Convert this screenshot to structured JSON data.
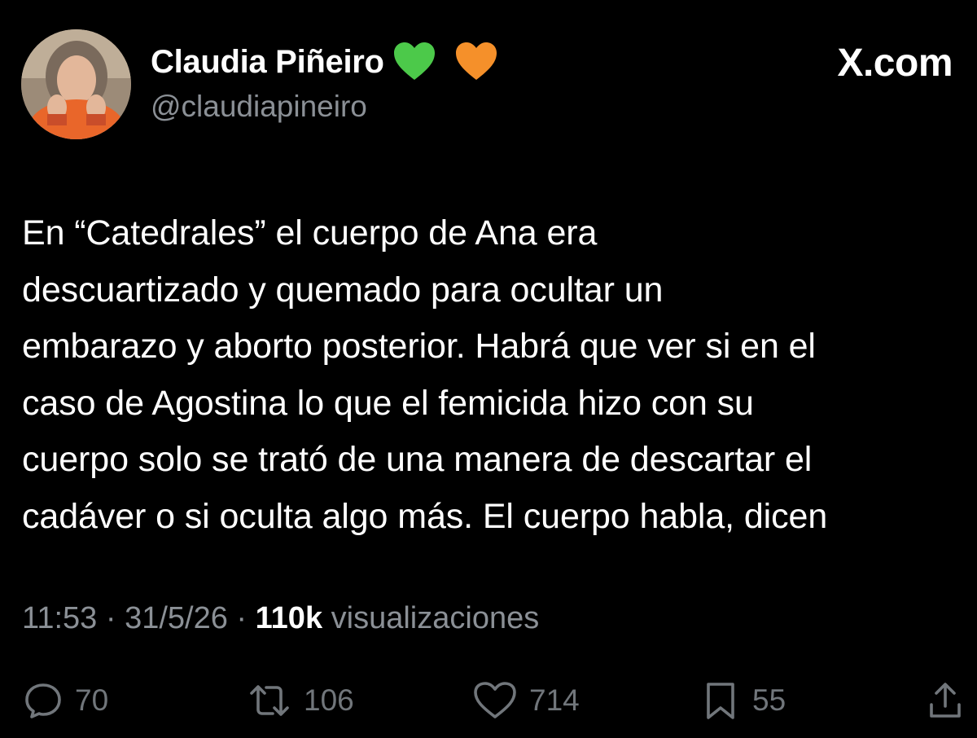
{
  "author": {
    "display_name": "Claudia Piñeiro",
    "handle": "@claudiapineiro",
    "badges": [
      "green-heart-icon",
      "orange-heart-icon"
    ],
    "avatar": "avatar-photo"
  },
  "brand": {
    "label": "X.com"
  },
  "tweet": {
    "lines": [
      "En “Catedrales” el cuerpo de Ana era",
      "descuartizado y quemado para ocultar un",
      "embarazo y aborto posterior. Habrá que ver si en el",
      "caso de Agostina lo que el femicida hizo con su",
      "cuerpo solo se trató de una manera de descartar el",
      "cadáver o si oculta algo más. El cuerpo habla, dicen"
    ]
  },
  "meta": {
    "time": "11:53",
    "sep1": " · ",
    "date": "31/5/26",
    "sep2": " · ",
    "views_count": "110k",
    "views_label": " visualizaciones"
  },
  "actions": {
    "replies": {
      "icon": "reply-icon",
      "count": "70"
    },
    "reposts": {
      "icon": "repost-icon",
      "count": "106"
    },
    "likes": {
      "icon": "heart-icon",
      "count": "714"
    },
    "bookmarks": {
      "icon": "bookmark-icon",
      "count": "55"
    },
    "share": {
      "icon": "share-icon"
    }
  },
  "colors": {
    "background": "#000000",
    "text": "#ffffff",
    "secondary": "#8b9096",
    "icon": "#71767b",
    "green_heart": "#4cc94a",
    "orange_heart": "#f5902a"
  }
}
